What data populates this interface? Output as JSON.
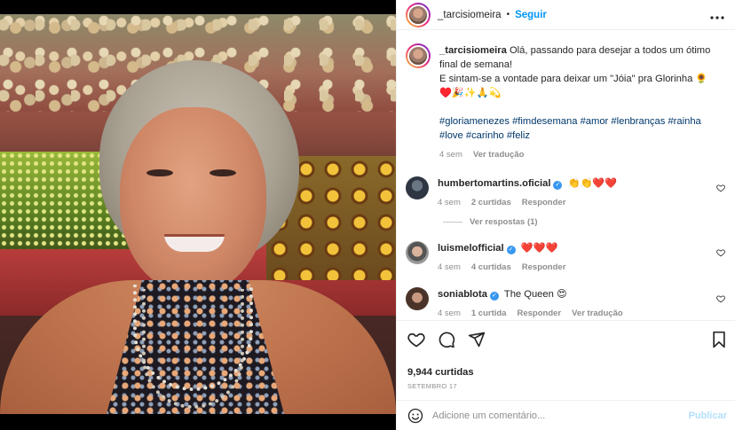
{
  "post": {
    "author": "_tarcisiomeira",
    "follow_label": "Seguir",
    "more_label": "•••"
  },
  "caption": {
    "author": "_tarcisiomeira",
    "text": "Olá, passando para desejar a todos um ótimo final de semana!",
    "line2": "E sintam-se a vontade para deixar um \"Jóia\" pra Glorinha 🌻",
    "emojis": "♥️🎉✨🙏💫",
    "hashtags": "#gloriamenezes #fimdesemana #amor #lenbranças #rainha #love #carinho #feliz",
    "time": "4 sem",
    "translate": "Ver tradução"
  },
  "comments": [
    {
      "user": "humbertomartins.oficial",
      "text": "👏👏❤️❤️",
      "time": "4 sem",
      "likes": "2 curtidas",
      "reply": "Responder",
      "view_replies": "Ver respostas (1)"
    },
    {
      "user": "luismelofficial",
      "text": "❤️❤️❤️",
      "time": "4 sem",
      "likes": "4 curtidas",
      "reply": "Responder"
    },
    {
      "user": "soniablota",
      "text": "The Queen 😍",
      "time": "4 sem",
      "likes": "1 curtida",
      "reply": "Responder",
      "translate": "Ver tradução"
    }
  ],
  "stats": {
    "likes": "9,944 curtidas",
    "date": "SETEMBRO 17"
  },
  "composer": {
    "placeholder": "Adicione um comentário...",
    "publish_label": "Publicar"
  },
  "colors": {
    "link_blue": "#0095f6",
    "hashtag_blue": "#00376b",
    "muted_gray": "#8e8e8e",
    "heart_red": "#ed4956",
    "publish_disabled": "#b2dffc"
  },
  "icons": [
    "heart-icon",
    "comment-icon",
    "share-icon",
    "bookmark-icon",
    "emoji-icon",
    "more-icon",
    "verified-icon"
  ]
}
